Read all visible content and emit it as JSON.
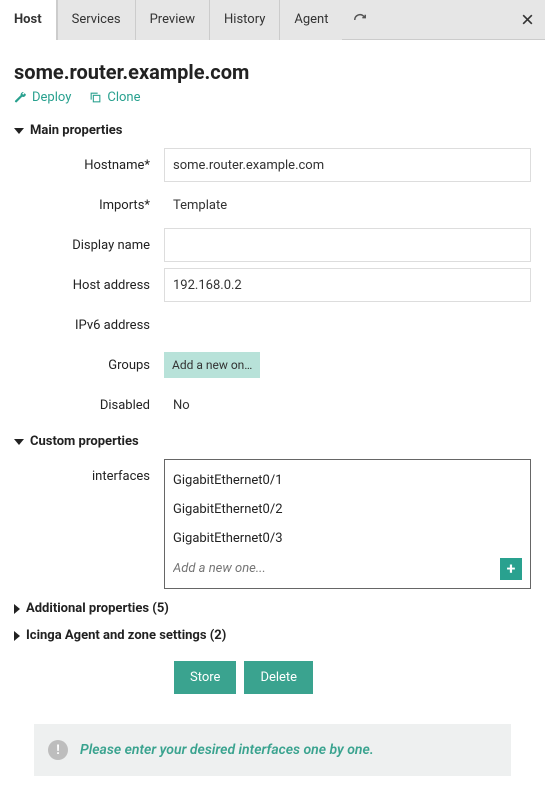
{
  "tabs": {
    "host": "Host",
    "services": "Services",
    "preview": "Preview",
    "history": "History",
    "agent": "Agent"
  },
  "title": "some.router.example.com",
  "actions": {
    "deploy": "Deploy",
    "clone": "Clone"
  },
  "sections": {
    "main": "Main properties",
    "custom": "Custom properties",
    "additional": "Additional properties (5)",
    "icinga": "Icinga Agent and zone settings (2)"
  },
  "labels": {
    "hostname": "Hostname*",
    "imports": "Imports*",
    "display_name": "Display name",
    "host_address": "Host address",
    "ipv6": "IPv6 address",
    "groups": "Groups",
    "disabled": "Disabled",
    "interfaces": "interfaces"
  },
  "values": {
    "hostname": "some.router.example.com",
    "imports": "Template",
    "display_name": "",
    "host_address": "192.168.0.2",
    "ipv6": "",
    "groups_placeholder": "Add a new on…",
    "disabled": "No",
    "interfaces": [
      "GigabitEthernet0/1",
      "GigabitEthernet0/2",
      "GigabitEthernet0/3"
    ],
    "interfaces_add_placeholder": "Add a new one..."
  },
  "buttons": {
    "store": "Store",
    "delete": "Delete"
  },
  "hint": "Please enter your desired interfaces one by one."
}
